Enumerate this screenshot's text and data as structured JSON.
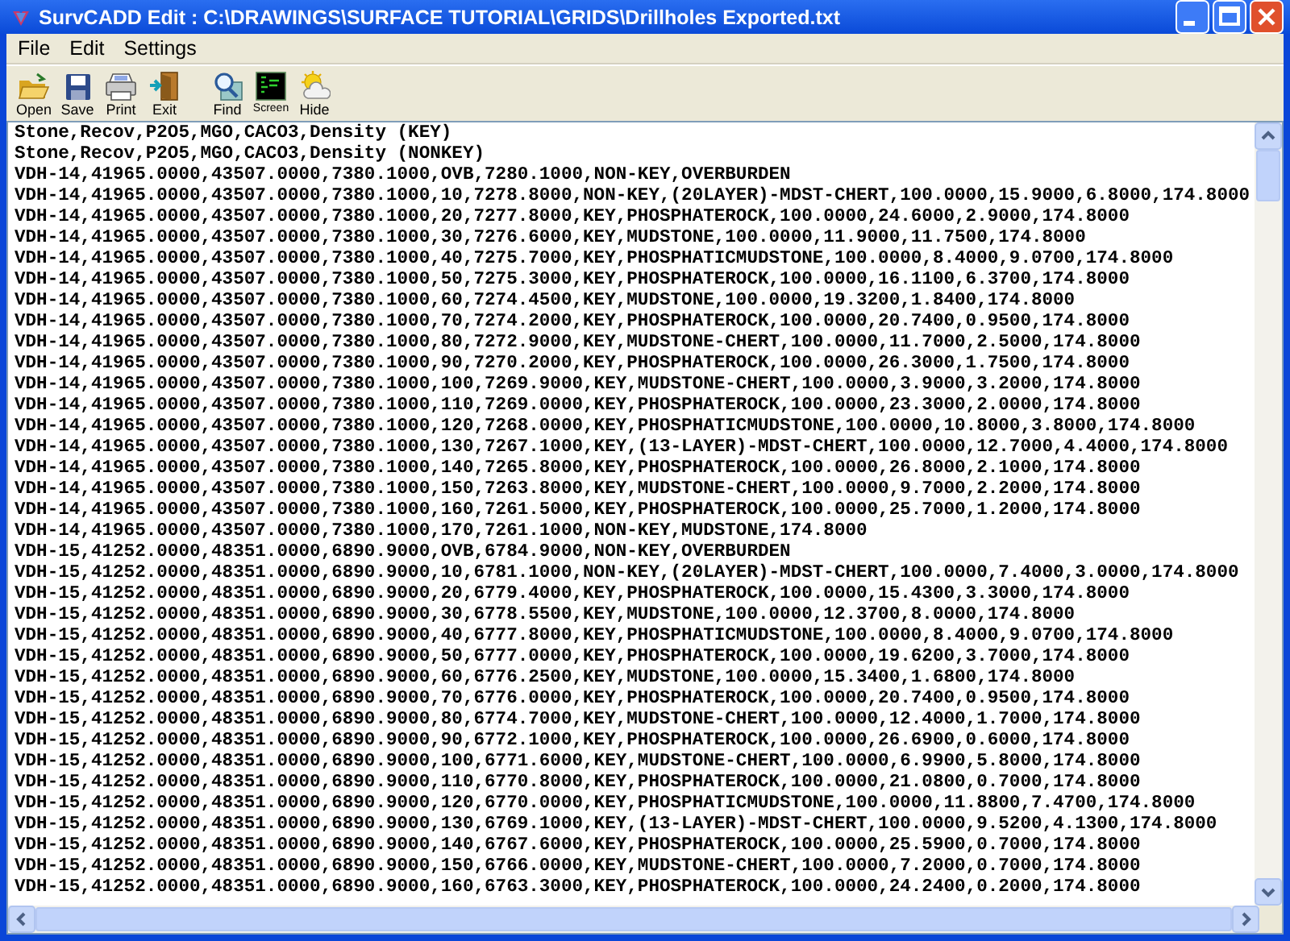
{
  "window": {
    "title": "SurvCADD Edit : C:\\DRAWINGS\\SURFACE TUTORIAL\\GRIDS\\Drillholes Exported.txt"
  },
  "menu": [
    "File",
    "Edit",
    "Settings"
  ],
  "toolbar": [
    {
      "kind": "open",
      "label": "Open"
    },
    {
      "kind": "save",
      "label": "Save"
    },
    {
      "kind": "print",
      "label": "Print"
    },
    {
      "kind": "exit",
      "label": "Exit"
    },
    {
      "kind": "find",
      "label": "Find"
    },
    {
      "kind": "screen",
      "label": "Screen"
    },
    {
      "kind": "hide",
      "label": "Hide"
    }
  ],
  "editor": {
    "lines": [
      "Stone,Recov,P2O5,MGO,CACO3,Density (KEY)",
      "Stone,Recov,P2O5,MGO,CACO3,Density (NONKEY)",
      "VDH-14,41965.0000,43507.0000,7380.1000,OVB,7280.1000,NON-KEY,OVERBURDEN",
      "VDH-14,41965.0000,43507.0000,7380.1000,10,7278.8000,NON-KEY,(20LAYER)-MDST-CHERT,100.0000,15.9000,6.8000,174.8000",
      "VDH-14,41965.0000,43507.0000,7380.1000,20,7277.8000,KEY,PHOSPHATEROCK,100.0000,24.6000,2.9000,174.8000",
      "VDH-14,41965.0000,43507.0000,7380.1000,30,7276.6000,KEY,MUDSTONE,100.0000,11.9000,11.7500,174.8000",
      "VDH-14,41965.0000,43507.0000,7380.1000,40,7275.7000,KEY,PHOSPHATICMUDSTONE,100.0000,8.4000,9.0700,174.8000",
      "VDH-14,41965.0000,43507.0000,7380.1000,50,7275.3000,KEY,PHOSPHATEROCK,100.0000,16.1100,6.3700,174.8000",
      "VDH-14,41965.0000,43507.0000,7380.1000,60,7274.4500,KEY,MUDSTONE,100.0000,19.3200,1.8400,174.8000",
      "VDH-14,41965.0000,43507.0000,7380.1000,70,7274.2000,KEY,PHOSPHATEROCK,100.0000,20.7400,0.9500,174.8000",
      "VDH-14,41965.0000,43507.0000,7380.1000,80,7272.9000,KEY,MUDSTONE-CHERT,100.0000,11.7000,2.5000,174.8000",
      "VDH-14,41965.0000,43507.0000,7380.1000,90,7270.2000,KEY,PHOSPHATEROCK,100.0000,26.3000,1.7500,174.8000",
      "VDH-14,41965.0000,43507.0000,7380.1000,100,7269.9000,KEY,MUDSTONE-CHERT,100.0000,3.9000,3.2000,174.8000",
      "VDH-14,41965.0000,43507.0000,7380.1000,110,7269.0000,KEY,PHOSPHATEROCK,100.0000,23.3000,2.0000,174.8000",
      "VDH-14,41965.0000,43507.0000,7380.1000,120,7268.0000,KEY,PHOSPHATICMUDSTONE,100.0000,10.8000,3.8000,174.8000",
      "VDH-14,41965.0000,43507.0000,7380.1000,130,7267.1000,KEY,(13-LAYER)-MDST-CHERT,100.0000,12.7000,4.4000,174.8000",
      "VDH-14,41965.0000,43507.0000,7380.1000,140,7265.8000,KEY,PHOSPHATEROCK,100.0000,26.8000,2.1000,174.8000",
      "VDH-14,41965.0000,43507.0000,7380.1000,150,7263.8000,KEY,MUDSTONE-CHERT,100.0000,9.7000,2.2000,174.8000",
      "VDH-14,41965.0000,43507.0000,7380.1000,160,7261.5000,KEY,PHOSPHATEROCK,100.0000,25.7000,1.2000,174.8000",
      "VDH-14,41965.0000,43507.0000,7380.1000,170,7261.1000,NON-KEY,MUDSTONE,174.8000",
      "VDH-15,41252.0000,48351.0000,6890.9000,OVB,6784.9000,NON-KEY,OVERBURDEN",
      "VDH-15,41252.0000,48351.0000,6890.9000,10,6781.1000,NON-KEY,(20LAYER)-MDST-CHERT,100.0000,7.4000,3.0000,174.8000",
      "VDH-15,41252.0000,48351.0000,6890.9000,20,6779.4000,KEY,PHOSPHATEROCK,100.0000,15.4300,3.3000,174.8000",
      "VDH-15,41252.0000,48351.0000,6890.9000,30,6778.5500,KEY,MUDSTONE,100.0000,12.3700,8.0000,174.8000",
      "VDH-15,41252.0000,48351.0000,6890.9000,40,6777.8000,KEY,PHOSPHATICMUDSTONE,100.0000,8.4000,9.0700,174.8000",
      "VDH-15,41252.0000,48351.0000,6890.9000,50,6777.0000,KEY,PHOSPHATEROCK,100.0000,19.6200,3.7000,174.8000",
      "VDH-15,41252.0000,48351.0000,6890.9000,60,6776.2500,KEY,MUDSTONE,100.0000,15.3400,1.6800,174.8000",
      "VDH-15,41252.0000,48351.0000,6890.9000,70,6776.0000,KEY,PHOSPHATEROCK,100.0000,20.7400,0.9500,174.8000",
      "VDH-15,41252.0000,48351.0000,6890.9000,80,6774.7000,KEY,MUDSTONE-CHERT,100.0000,12.4000,1.7000,174.8000",
      "VDH-15,41252.0000,48351.0000,6890.9000,90,6772.1000,KEY,PHOSPHATEROCK,100.0000,26.6900,0.6000,174.8000",
      "VDH-15,41252.0000,48351.0000,6890.9000,100,6771.6000,KEY,MUDSTONE-CHERT,100.0000,6.9900,5.8000,174.8000",
      "VDH-15,41252.0000,48351.0000,6890.9000,110,6770.8000,KEY,PHOSPHATEROCK,100.0000,21.0800,0.7000,174.8000",
      "VDH-15,41252.0000,48351.0000,6890.9000,120,6770.0000,KEY,PHOSPHATICMUDSTONE,100.0000,11.8800,7.4700,174.8000",
      "VDH-15,41252.0000,48351.0000,6890.9000,130,6769.1000,KEY,(13-LAYER)-MDST-CHERT,100.0000,9.5200,4.1300,174.8000",
      "VDH-15,41252.0000,48351.0000,6890.9000,140,6767.6000,KEY,PHOSPHATEROCK,100.0000,25.5900,0.7000,174.8000",
      "VDH-15,41252.0000,48351.0000,6890.9000,150,6766.0000,KEY,MUDSTONE-CHERT,100.0000,7.2000,0.7000,174.8000",
      "VDH-15,41252.0000,48351.0000,6890.9000,160,6763.3000,KEY,PHOSPHATEROCK,100.0000,24.2400,0.2000,174.8000"
    ]
  }
}
